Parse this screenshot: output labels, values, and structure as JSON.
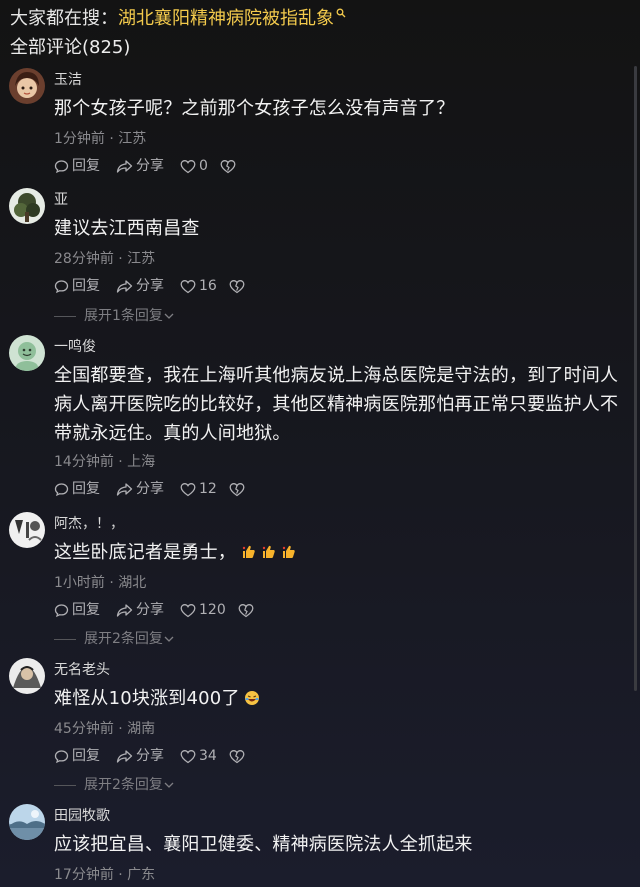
{
  "search": {
    "prefix": "大家都在搜：",
    "topic": "湖北襄阳精神病院被指乱象"
  },
  "comments_header": {
    "label": "全部评论(825)"
  },
  "comments": [
    {
      "username": "玉洁",
      "text": "那个女孩子呢？之前那个女孩子怎么没有声音了？",
      "meta": "1分钟前 · 江苏",
      "reply_label": "回复",
      "share_label": "分享",
      "likes": "0"
    },
    {
      "username": "亚",
      "text": "建议去江西南昌查",
      "meta": "28分钟前 · 江苏",
      "reply_label": "回复",
      "share_label": "分享",
      "likes": "16",
      "expand_label": "展开1条回复"
    },
    {
      "username": "一鸣俊",
      "text": "全国都要查，我在上海听其他病友说上海总医院是守法的，到了时间人病人离开医院吃的比较好，其他区精神病医院那怕再正常只要监护人不带就永远住。真的人间地狱。",
      "meta": "14分钟前 · 上海",
      "reply_label": "回复",
      "share_label": "分享",
      "likes": "12"
    },
    {
      "username": "阿杰，！，",
      "text": "这些卧底记者是勇士，",
      "emoji": "thumbs-up-emoji x3",
      "meta": "1小时前 · 湖北",
      "reply_label": "回复",
      "share_label": "分享",
      "likes": "120",
      "expand_label": "展开2条回复"
    },
    {
      "username": "无名老头",
      "text": "难怪从10块涨到400了",
      "emoji": "laughing-crying-emoji",
      "meta": "45分钟前 · 湖南",
      "reply_label": "回复",
      "share_label": "分享",
      "likes": "34",
      "expand_label": "展开2条回复"
    },
    {
      "username": "田园牧歌",
      "text": "应该把宜昌、襄阳卫健委、精神病医院法人全抓起来",
      "meta": "17分钟前 · 广东"
    }
  ],
  "colors": {
    "topic_accent": "#f2c94c",
    "text_primary": "#f2f2f2",
    "text_secondary": "#8a8a8e",
    "background": "#141414"
  },
  "icons": [
    "search-sparkle-icon",
    "comment-bubble-icon",
    "share-arrow-icon",
    "heart-icon",
    "broken-heart-icon",
    "chevron-down-icon"
  ]
}
